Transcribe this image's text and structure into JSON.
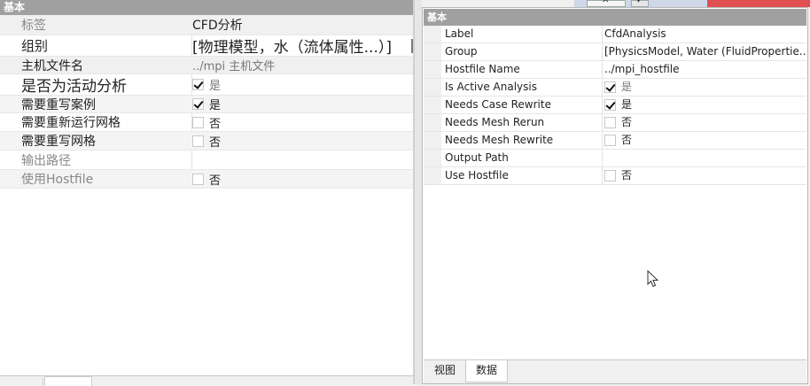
{
  "left_panel": {
    "header": "基本",
    "rows": [
      {
        "label": "标签",
        "value": "CFD分析"
      },
      {
        "label": "组别",
        "value": "[物理模型，水（流体属性...）]"
      },
      {
        "label": "主机文件名",
        "value": "../mpi 主机文件"
      },
      {
        "label": "是否为活动分析",
        "value": "是"
      },
      {
        "label": "需要重写案例",
        "value": "是"
      },
      {
        "label": "需要重新运行网格",
        "value": "否"
      },
      {
        "label": "需要重写网格",
        "value": "否"
      },
      {
        "label": "输出路径",
        "value": ""
      },
      {
        "label": "使用Hostfile",
        "value": "否"
      }
    ]
  },
  "right_panel": {
    "header": "基本",
    "rows": [
      {
        "label": "Label",
        "value": "CfdAnalysis"
      },
      {
        "label": "Group",
        "value": "[PhysicsModel, Water (FluidPropertie..."
      },
      {
        "label": "Hostfile Name",
        "value": "../mpi_hostfile"
      },
      {
        "label": "Is Active Analysis",
        "value": "是"
      },
      {
        "label": "Needs Case Rewrite",
        "value": "是"
      },
      {
        "label": "Needs Mesh Rerun",
        "value": "否"
      },
      {
        "label": "Needs Mesh Rewrite",
        "value": "否"
      },
      {
        "label": "Output Path",
        "value": ""
      },
      {
        "label": "Use Hostfile",
        "value": "否"
      }
    ],
    "tabs": [
      {
        "label": "视图"
      },
      {
        "label": "数据"
      }
    ]
  },
  "topstrip": {
    "close_glyph": "✕",
    "dropdown_glyph": "▾"
  },
  "icons": {
    "cursor": "mouse-pointer-icon"
  },
  "colors": {
    "header_bg": "#a0a0a0",
    "gutter": "#f0f0f0"
  }
}
